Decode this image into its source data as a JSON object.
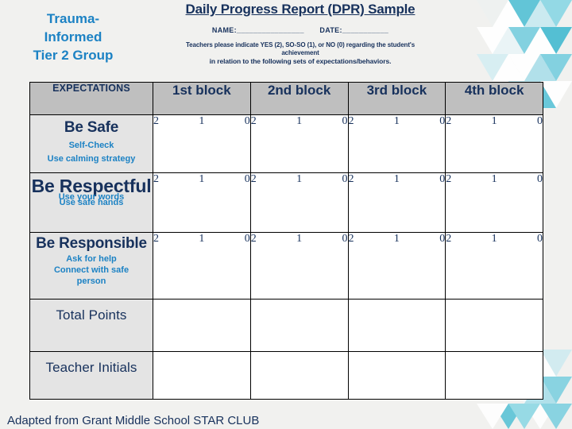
{
  "group_title": {
    "line1": "Trauma-",
    "line2": "Informed",
    "line3": "Tier 2 Group"
  },
  "header": {
    "title": "Daily Progress Report (DPR) Sample",
    "name_label": "NAME:________________",
    "date_label": "DATE:___________",
    "instructions_line1": "Teachers please indicate YES (2), SO-SO (1), or NO (0) regarding the student's",
    "instructions_line2": "achievement",
    "instructions_line3": "in relation to the following sets of expectations/behaviors."
  },
  "table": {
    "columns": {
      "expectations": "EXPECTATIONS",
      "blocks": [
        "1st block",
        "2nd block",
        "3rd block",
        "4th block"
      ]
    },
    "scores": [
      "2",
      "1",
      "0"
    ],
    "rows": [
      {
        "key": "be-safe",
        "title": "Be Safe",
        "sub": [
          "Self-Check",
          "Use calming strategy"
        ],
        "has_scores": true
      },
      {
        "key": "be-respectful",
        "title": "Be Respectful",
        "sub": [
          "Use your words",
          "Use safe hands"
        ],
        "has_scores": true
      },
      {
        "key": "be-responsible",
        "title": "Be Responsible",
        "sub": [
          "Ask for help",
          "Connect with safe",
          "person"
        ],
        "has_scores": true
      },
      {
        "key": "total-points",
        "title": "Total Points",
        "sub": [],
        "has_scores": false
      },
      {
        "key": "teacher-initials",
        "title": "Teacher Initials",
        "sub": [],
        "has_scores": false
      }
    ]
  },
  "footer": {
    "note": "Adapted from Grant Middle School STAR CLUB"
  },
  "colors": {
    "accent_blue": "#1c82c4",
    "navy": "#17315c",
    "header_fill": "#bfbfbf",
    "label_fill": "#e4e4e4",
    "page_bg": "#f1f1ef",
    "deco_teal": "#56c4d8",
    "deco_light": "#bfe8f0"
  }
}
